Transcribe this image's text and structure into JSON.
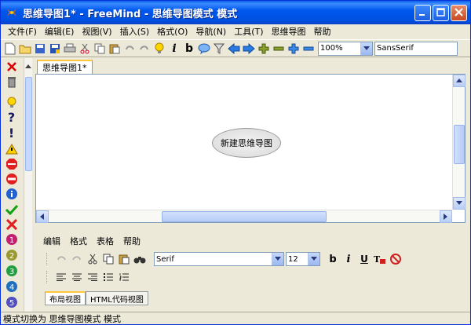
{
  "window": {
    "title": "思维导图1* - FreeMind - 思维导图模式 模式",
    "controls": [
      "minimize-icon",
      "maximize-icon",
      "close-icon"
    ]
  },
  "menubar": {
    "items": [
      "文件(F)",
      "编辑(E)",
      "视图(V)",
      "插入(S)",
      "格式(O)",
      "导航(N)",
      "工具(T)",
      "思维导图",
      "帮助"
    ]
  },
  "toolbar": {
    "zoom_value": "100%",
    "font_value": "SansSerif"
  },
  "map": {
    "tab_label": "思维导图1*",
    "root_node_text": "新建思维导图"
  },
  "editor": {
    "menu_items": [
      "编辑",
      "格式",
      "表格",
      "帮助"
    ],
    "font_value": "Serif",
    "size_value": "12",
    "tabs": [
      "布局视图",
      "HTML代码视图"
    ]
  },
  "statusbar": {
    "text": "模式切换为 思维导图模式 模式"
  },
  "colors": {
    "titlebar": "#0058ee",
    "accent_tab": "#ffc83c",
    "window_bg": "#ece9d8"
  }
}
